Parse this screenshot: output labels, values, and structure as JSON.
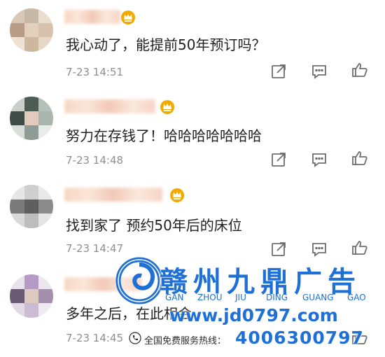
{
  "comments": [
    {
      "text": "我心动了，能提前50年预订吗？",
      "time": "7-23 14:51",
      "actions": [
        "share-icon",
        "comment-icon",
        "like-icon"
      ]
    },
    {
      "text": "努力在存钱了！哈哈哈哈哈哈哈",
      "time": "7-23 14:48",
      "actions": [
        "share-icon",
        "comment-icon",
        "like-icon"
      ]
    },
    {
      "text": "找到家了 预约50年后的床位",
      "time": "7-23 14:47",
      "actions": [
        "share-icon",
        "comment-icon",
        "like-icon"
      ]
    },
    {
      "text": "多年之后，在此相会",
      "time": "7-23 14:45",
      "actions": [
        "share-icon",
        "comment-icon",
        "like-icon"
      ]
    }
  ],
  "watermark": {
    "title": "赣州九鼎广告",
    "pinyin": [
      "GAN",
      "ZHOU",
      "JIU",
      "DING",
      "GUANG",
      "GAO"
    ],
    "url": "www.jd0797.com",
    "hotline_label": "全国免费服务热线：",
    "phone": "4006300797",
    "brand_color": "#1e6fd6"
  },
  "colors": {
    "text": "#1f1f1f",
    "time": "#8f8f8f",
    "icon": "#6e6e6e",
    "crown": "#f2a900"
  }
}
